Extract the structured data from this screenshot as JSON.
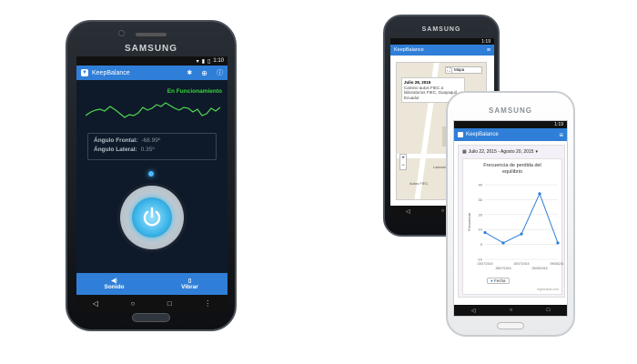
{
  "phone_main": {
    "brand": "SAMSUNG",
    "status_time": "1:10",
    "app_title": "KeepBalance",
    "status_label": "En Funcionamiento",
    "angle_front_label": "Ángulo Frontal:",
    "angle_front_value": "-68.99º",
    "angle_side_label": "Ángulo Lateral:",
    "angle_side_value": "0.35º",
    "btn_sound_label": "Sonido",
    "btn_vibrate_label": "Vibrar",
    "colors": {
      "appbar": "#2f7fd8",
      "screen_bg": "#0e1a2a",
      "wave": "#4fd84f",
      "status": "#36d636",
      "power_ring": "#3ab4e8"
    }
  },
  "phone_back": {
    "brand": "SAMSUNG",
    "status_time": "1:19",
    "app_title": "KeepBalance",
    "map_type_label": "Mapa",
    "popup_date": "Julio 28, 2015",
    "popup_text": "Camino autos FIEC a laboratorios FIEC, Guayaquil, Ecuador",
    "map_street_labels": [
      "Auditorio",
      "Laboratorios",
      "Autos FIEC"
    ]
  },
  "phone_front": {
    "brand": "SAMSUNG",
    "status_time": "1:19",
    "app_title": "KeepBalance",
    "date_range": "Julio 22, 2015 - Agosto 20, 2015",
    "chart_title": "Frecuencia de perdida del equilibrio",
    "ylabel": "Frecuencia",
    "legend_label": "Fecha",
    "credit": "highcharts.com"
  },
  "chart_data": {
    "type": "line",
    "title": "Frecuencia de perdida del equilibrio",
    "xlabel": "",
    "ylabel": "Frecuencia",
    "x": [
      "23/07/2015",
      "28/07/2015",
      "30/07/2015",
      "05/08/2015",
      "09/08/2015"
    ],
    "series": [
      {
        "name": "Fecha",
        "values": [
          8,
          1,
          7,
          34,
          1
        ]
      }
    ],
    "ylim": [
      -10,
      40
    ],
    "yticks": [
      -10,
      0,
      10,
      20,
      30,
      40
    ],
    "grid": true,
    "legend": "bottom"
  }
}
